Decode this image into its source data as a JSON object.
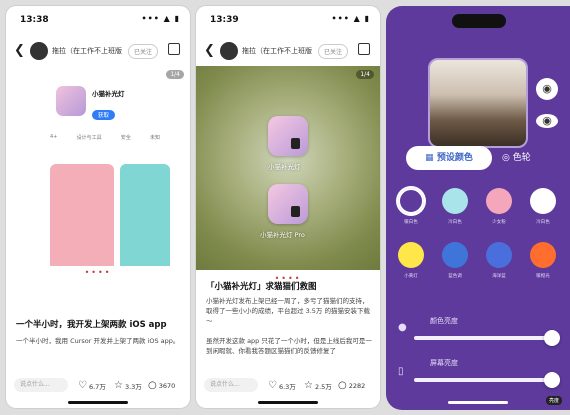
{
  "left_phone": {
    "status_time": "13:38",
    "status_icons": "••• ▲ ▮",
    "author": "拖拉（在工作不上班版",
    "follow_label": "已关注",
    "page_badge": "1/4",
    "mini_app_name": "小猫补光灯",
    "mini_get": "获取",
    "mini_stats": [
      "4+",
      "设计与工具",
      "安全",
      "未知"
    ],
    "title": "一个半小时，我开发上架两款 iOS app",
    "body": "一个半小时，我用 Cursor 开发并上架了两款 iOS app。",
    "comment_placeholder": "说点什么...",
    "likes": "6.7万",
    "collects": "3.3万",
    "comments": "3670"
  },
  "mid_phone": {
    "status_time": "13:39",
    "status_icons": "••• ▲ ▮",
    "author": "拖拉（在工作不上班版",
    "follow_label": "已关注",
    "page_badge": "1/4",
    "app1_label": "小猫补光灯",
    "app2_label": "小猫补光灯 Pro",
    "title": "「小猫补光灯」求猫猫们救图",
    "body1": "小猫补光灯发布上架已经一周了，多亏了猫猫们的支持，取得了一些小小的成绩，平台超过 3.5万 的猫猫安装下载～",
    "body2": "虽然开发这款 app 只花了一个小时，但是上线后我可是一到闲暇就、你看我答题区猫猫们的反馈修复了",
    "comment_placeholder": "说点什么...",
    "likes": "6.3万",
    "collects": "2.5万",
    "comments": "2282"
  },
  "panel": {
    "tab_active": "预设颜色",
    "tab_inactive": "色轮",
    "swatches": [
      {
        "name": "暖白色",
        "color": "#6a3fab",
        "selected": true
      },
      {
        "name": "冷白色",
        "color": "#a8e4ea"
      },
      {
        "name": "少女粉",
        "color": "#f4a7bb"
      },
      {
        "name": "冷白色",
        "color": "#ffffff"
      },
      {
        "name": "小黄灯",
        "color": "#ffe74a"
      },
      {
        "name": "蓝色调",
        "color": "#3f74d9"
      },
      {
        "name": "海洋蓝",
        "color": "#4a6fdc"
      },
      {
        "name": "暖橙光",
        "color": "#ff6e2e"
      }
    ],
    "brightness_label": "颜色亮度",
    "screen_label": "屏幕亮度",
    "brightness_value": 1.0,
    "screen_value": 1.0,
    "badge": "亮度"
  }
}
